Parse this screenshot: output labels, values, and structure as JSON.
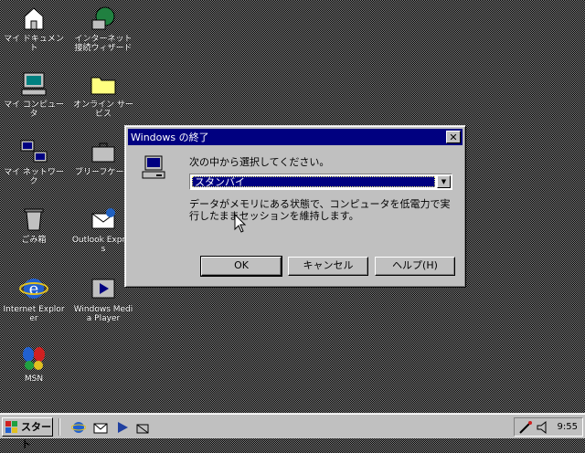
{
  "desktop": {
    "icons": [
      {
        "id": "my-documents",
        "label": "マイ ドキュメント",
        "icon": "folder-house-icon"
      },
      {
        "id": "internet-connection",
        "label": "インターネット接続ウィザード",
        "icon": "globe-icon"
      },
      {
        "id": "my-computer",
        "label": "マイ コンピュータ",
        "icon": "computer-icon"
      },
      {
        "id": "online-services",
        "label": "オンライン サービス",
        "icon": "folder-icon"
      },
      {
        "id": "my-network",
        "label": "マイ ネットワーク",
        "icon": "network-icon"
      },
      {
        "id": "briefcase",
        "label": "ブリーフケース",
        "icon": "briefcase-icon"
      },
      {
        "id": "recycle-bin",
        "label": "ごみ箱",
        "icon": "recycle-bin-icon"
      },
      {
        "id": "outlook-express",
        "label": "Outlook Express",
        "icon": "outlook-icon"
      },
      {
        "id": "internet-explorer",
        "label": "Internet Explorer",
        "icon": "ie-icon"
      },
      {
        "id": "media-player",
        "label": "Windows Media Player",
        "icon": "media-player-icon"
      },
      {
        "id": "msn",
        "label": "MSN",
        "icon": "msn-butterfly-icon"
      }
    ]
  },
  "dialog": {
    "title": "Windows の終了",
    "close_label": "✕",
    "prompt": "次の中から選択してください。",
    "selected_option": "スタンバイ",
    "description": "データがメモリにある状態で、コンピュータを低電力で実行したままセッションを維持します。",
    "buttons": {
      "ok": "OK",
      "cancel": "キャンセル",
      "help": "ヘルプ(H)"
    }
  },
  "taskbar": {
    "start_label": "スタート",
    "clock": "9:55"
  }
}
